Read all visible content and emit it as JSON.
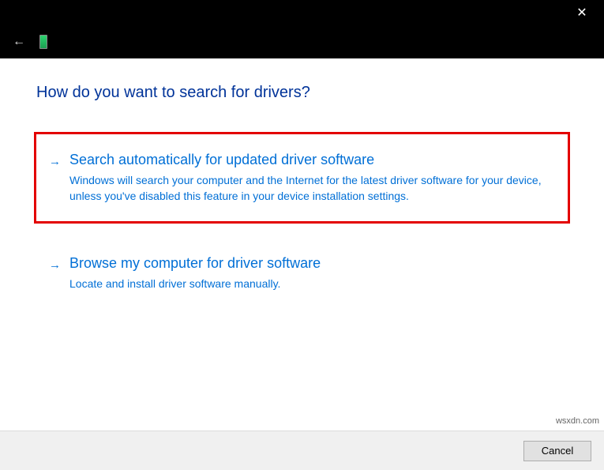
{
  "heading": "How do you want to search for drivers?",
  "options": [
    {
      "title": "Search automatically for updated driver software",
      "desc": "Windows will search your computer and the Internet for the latest driver software for your device, unless you've disabled this feature in your device installation settings."
    },
    {
      "title": "Browse my computer for driver software",
      "desc": "Locate and install driver software manually."
    }
  ],
  "footer": {
    "cancel": "Cancel"
  },
  "watermark": "wsxdn.com"
}
